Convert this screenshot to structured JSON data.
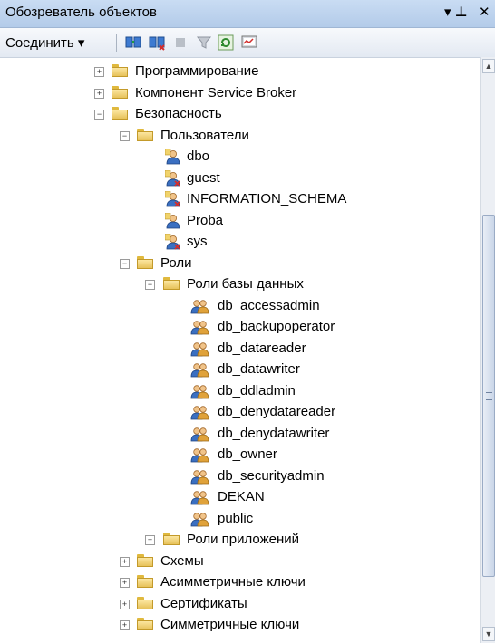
{
  "title": "Обозреватель объектов",
  "title_controls": {
    "pin": "▾ ⊥",
    "close": "✕"
  },
  "toolbar": {
    "connect_label": "Соединить ▾"
  },
  "tree": [
    {
      "label": "Программирование",
      "level": 0,
      "expander": "+",
      "icon": "folder"
    },
    {
      "label": "Компонент Service Broker",
      "level": 0,
      "expander": "+",
      "icon": "folder"
    },
    {
      "label": "Безопасность",
      "level": 0,
      "expander": "-",
      "icon": "folder"
    },
    {
      "label": "Пользователи",
      "level": 1,
      "expander": "-",
      "icon": "folder"
    },
    {
      "label": "dbo",
      "level": 2,
      "expander": "",
      "icon": "user"
    },
    {
      "label": "guest",
      "level": 2,
      "expander": "",
      "icon": "user-disabled"
    },
    {
      "label": "INFORMATION_SCHEMA",
      "level": 2,
      "expander": "",
      "icon": "user-disabled"
    },
    {
      "label": "Proba",
      "level": 2,
      "expander": "",
      "icon": "user"
    },
    {
      "label": "sys",
      "level": 2,
      "expander": "",
      "icon": "user-disabled"
    },
    {
      "label": "Роли",
      "level": 1,
      "expander": "-",
      "icon": "folder"
    },
    {
      "label": "Роли базы данных",
      "level": 2,
      "expander": "-",
      "icon": "folder"
    },
    {
      "label": "db_accessadmin",
      "level": 3,
      "expander": "",
      "icon": "role"
    },
    {
      "label": "db_backupoperator",
      "level": 3,
      "expander": "",
      "icon": "role"
    },
    {
      "label": "db_datareader",
      "level": 3,
      "expander": "",
      "icon": "role"
    },
    {
      "label": "db_datawriter",
      "level": 3,
      "expander": "",
      "icon": "role"
    },
    {
      "label": "db_ddladmin",
      "level": 3,
      "expander": "",
      "icon": "role"
    },
    {
      "label": "db_denydatareader",
      "level": 3,
      "expander": "",
      "icon": "role"
    },
    {
      "label": "db_denydatawriter",
      "level": 3,
      "expander": "",
      "icon": "role"
    },
    {
      "label": "db_owner",
      "level": 3,
      "expander": "",
      "icon": "role"
    },
    {
      "label": "db_securityadmin",
      "level": 3,
      "expander": "",
      "icon": "role"
    },
    {
      "label": "DEKAN",
      "level": 3,
      "expander": "",
      "icon": "role"
    },
    {
      "label": "public",
      "level": 3,
      "expander": "",
      "icon": "role"
    },
    {
      "label": "Роли приложений",
      "level": 2,
      "expander": "+",
      "icon": "folder"
    },
    {
      "label": "Схемы",
      "level": 1,
      "expander": "+",
      "icon": "folder"
    },
    {
      "label": "Асимметричные ключи",
      "level": 1,
      "expander": "+",
      "icon": "folder"
    },
    {
      "label": "Сертификаты",
      "level": 1,
      "expander": "+",
      "icon": "folder"
    },
    {
      "label": "Симметричные ключи",
      "level": 1,
      "expander": "+",
      "icon": "folder"
    }
  ],
  "colors": {
    "titlebar": "#b3cbe9",
    "folder": "#e7c25a",
    "user": "#3a6fc1",
    "role": "#d9a23a"
  }
}
